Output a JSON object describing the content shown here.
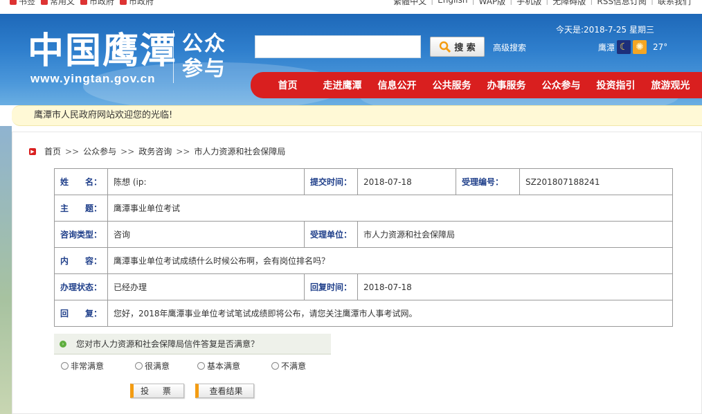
{
  "topbar": {
    "left_items": [
      "书签",
      "常用文",
      "市政府",
      "市政府"
    ],
    "right_items": [
      "繁體中文",
      "English",
      "WAP版",
      "手机版",
      "无障碍版",
      "RSS信息订阅",
      "联系我们"
    ]
  },
  "header": {
    "logo_text": "中国鹰潭",
    "logo_url": "www.yingtan.gov.cn",
    "logo_sub": "公众参与",
    "search_placeholder": "",
    "search_button": "搜 索",
    "advanced_search": "高级搜索",
    "date_text": "今天是:2018-7-25 星期三",
    "weather_city": "鹰潭",
    "weather_temp": "27°",
    "weather_icons": [
      "moon-icon",
      "sun-icon"
    ]
  },
  "nav": {
    "items": [
      "首页",
      "走进鹰潭",
      "信息公开",
      "公共服务",
      "办事服务",
      "公众参与",
      "投资指引",
      "旅游观光"
    ]
  },
  "welcome": "鹰潭市人民政府网站欢迎您的光临!",
  "breadcrumb": {
    "items": [
      "首页",
      "公众参与",
      "政务咨询",
      "市人力资源和社会保障局"
    ],
    "separator": ">>"
  },
  "detail": {
    "name_label": "姓　　名：",
    "name_value": "陈想 (ip:",
    "submit_time_label": "提交时间：",
    "submit_time_value": "2018-07-18",
    "accept_no_label": "受理编号：",
    "accept_no_value": "SZ201807188241",
    "subject_label": "主　　题：",
    "subject_value": "鹰潭事业单位考试",
    "type_label": "咨询类型：",
    "type_value": "咨询",
    "unit_label": "受理单位：",
    "unit_value": "市人力资源和社会保障局",
    "content_label": "内　　容：",
    "content_value": "鹰潭事业单位考试成绩什么时候公布啊，会有岗位排名吗？",
    "status_label": "办理状态：",
    "status_value": "已经办理",
    "reply_time_label": "回复时间：",
    "reply_time_value": "2018-07-18",
    "reply_label": "回　　复：",
    "reply_value": "您好，2018年鹰潭事业单位考试笔试成绩即将公布，请您关注鹰潭市人事考试网。"
  },
  "survey": {
    "question": "您对市人力资源和社会保障局信件答复是否满意？",
    "options": [
      "非常满意",
      "很满意",
      "基本满意",
      "不满意"
    ],
    "vote_button": "投 票",
    "result_button": "查看结果"
  },
  "colors": {
    "header_blue": "#2f7fcd",
    "nav_red": "#d91f1f",
    "label_blue": "#1f3f8a",
    "welcome_bg": "#fff9d6"
  }
}
